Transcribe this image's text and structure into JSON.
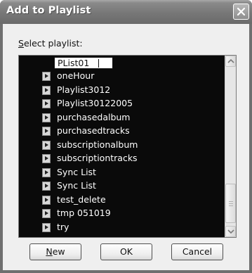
{
  "window": {
    "title": "Add to Playlist"
  },
  "prompt": {
    "mnemonic": "S",
    "rest": "elect playlist:"
  },
  "edit_value": "PList01",
  "playlists": [
    "oneHour",
    "Playlist3012",
    "Playlist30122005",
    "purchasedalbum",
    "purchasedtracks",
    "subscriptionalbum",
    "subscriptiontracks",
    "Sync List",
    "Sync List",
    "test_delete",
    "tmp 051019",
    "try"
  ],
  "buttons": {
    "new_mnemonic": "N",
    "new_rest": "ew",
    "ok": "OK",
    "cancel": "Cancel"
  },
  "icons": {
    "close": "close-icon",
    "playlist": "playlist-icon",
    "scroll_up": "scroll-up-arrow-icon",
    "scroll_down": "scroll-down-arrow-icon"
  }
}
